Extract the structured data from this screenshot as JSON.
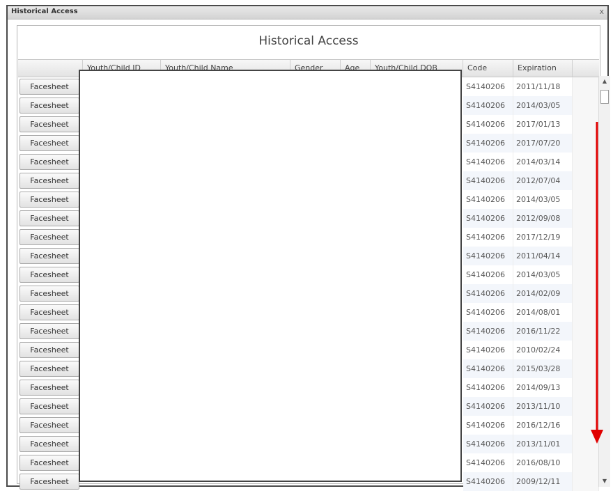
{
  "window": {
    "title": "Historical Access",
    "close_glyph": "x"
  },
  "grid": {
    "caption": "Historical Access",
    "columns": [
      "",
      "Youth/Child ID",
      "Youth/Child Name",
      "Gender",
      "Age",
      "Youth/Child DOB",
      "Code",
      "Expiration"
    ],
    "rows": [
      {
        "button": "Facesheet",
        "code": "S4140206",
        "expiration": "2011/11/18"
      },
      {
        "button": "Facesheet",
        "code": "S4140206",
        "expiration": "2014/03/05"
      },
      {
        "button": "Facesheet",
        "code": "S4140206",
        "expiration": "2017/01/13"
      },
      {
        "button": "Facesheet",
        "code": "S4140206",
        "expiration": "2017/07/20"
      },
      {
        "button": "Facesheet",
        "code": "S4140206",
        "expiration": "2014/03/14"
      },
      {
        "button": "Facesheet",
        "code": "S4140206",
        "expiration": "2012/07/04"
      },
      {
        "button": "Facesheet",
        "code": "S4140206",
        "expiration": "2014/03/05"
      },
      {
        "button": "Facesheet",
        "code": "S4140206",
        "expiration": "2012/09/08"
      },
      {
        "button": "Facesheet",
        "code": "S4140206",
        "expiration": "2017/12/19"
      },
      {
        "button": "Facesheet",
        "code": "S4140206",
        "expiration": "2011/04/14"
      },
      {
        "button": "Facesheet",
        "code": "S4140206",
        "expiration": "2014/03/05"
      },
      {
        "button": "Facesheet",
        "code": "S4140206",
        "expiration": "2014/02/09"
      },
      {
        "button": "Facesheet",
        "code": "S4140206",
        "expiration": "2014/08/01"
      },
      {
        "button": "Facesheet",
        "code": "S4140206",
        "expiration": "2016/11/22"
      },
      {
        "button": "Facesheet",
        "code": "S4140206",
        "expiration": "2010/02/24"
      },
      {
        "button": "Facesheet",
        "code": "S4140206",
        "expiration": "2015/03/28"
      },
      {
        "button": "Facesheet",
        "code": "S4140206",
        "expiration": "2014/09/13"
      },
      {
        "button": "Facesheet",
        "code": "S4140206",
        "expiration": "2013/11/10"
      },
      {
        "button": "Facesheet",
        "code": "S4140206",
        "expiration": "2016/12/16"
      },
      {
        "button": "Facesheet",
        "code": "S4140206",
        "expiration": "2013/11/01"
      },
      {
        "button": "Facesheet",
        "code": "S4140206",
        "expiration": "2016/08/10"
      },
      {
        "button": "Facesheet",
        "code": "S4140206",
        "expiration": "2009/12/11"
      }
    ]
  },
  "scrollbar": {
    "up_glyph": "▲",
    "down_glyph": "▼"
  },
  "annotation": {
    "color": "#e00000",
    "icon": "down-arrow-icon"
  }
}
